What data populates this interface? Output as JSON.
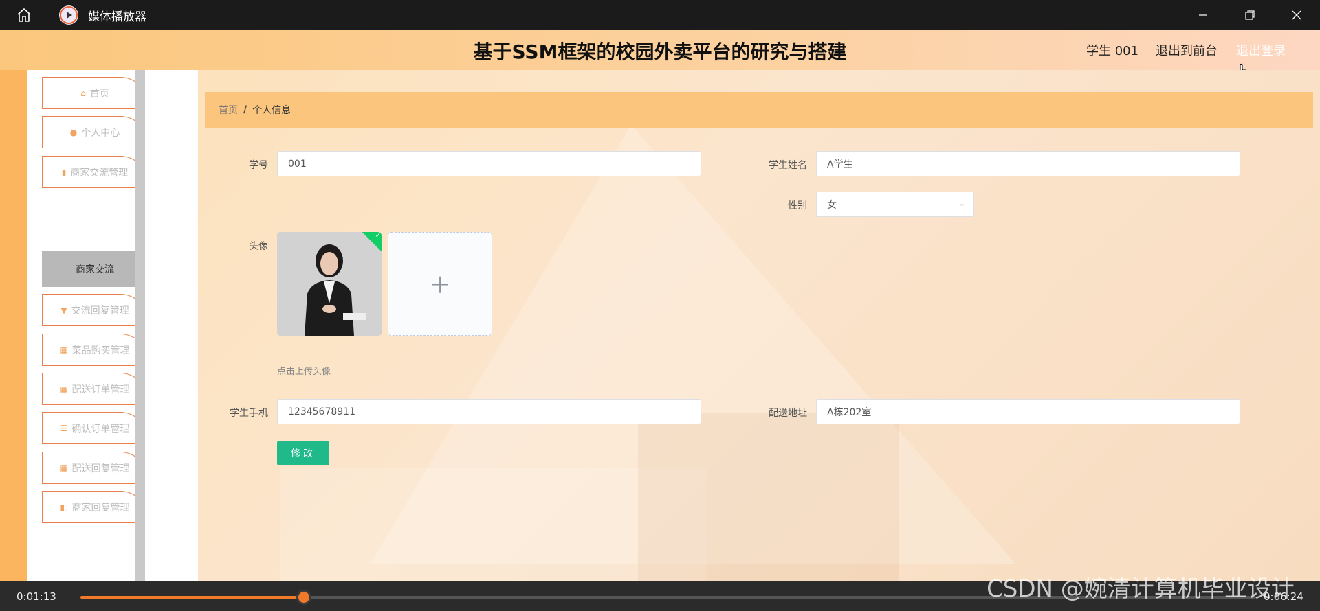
{
  "window": {
    "title": "媒体播放器",
    "controls": [
      "minimize",
      "restore",
      "close"
    ]
  },
  "header": {
    "title": "基于SSM框架的校园外卖平台的研究与搭建",
    "user": "学生 001",
    "back_to_front": "退出到前台",
    "logout": "退出登录"
  },
  "sidebar": {
    "items": [
      {
        "label": "首页",
        "icon": "home-icon",
        "has_submenu": false
      },
      {
        "label": "个人中心",
        "icon": "user-icon",
        "has_submenu": true
      },
      {
        "label": "商家交流管理",
        "icon": "chart-icon",
        "has_submenu": true
      },
      {
        "label": "交流回复管理",
        "icon": "flag-icon",
        "has_submenu": true
      },
      {
        "label": "菜品购买管理",
        "icon": "grid-icon",
        "has_submenu": true
      },
      {
        "label": "配送订单管理",
        "icon": "grid-icon",
        "has_submenu": true
      },
      {
        "label": "确认订单管理",
        "icon": "list-icon",
        "has_submenu": true
      },
      {
        "label": "配送回复管理",
        "icon": "grid-icon",
        "has_submenu": true
      },
      {
        "label": "商家回复管理",
        "icon": "thumb-icon",
        "has_submenu": true
      }
    ],
    "expanded_submenu": "商家交流"
  },
  "breadcrumb": {
    "home": "首页",
    "separator": "/",
    "current": "个人信息"
  },
  "form": {
    "student_id_label": "学号",
    "student_id_value": "001",
    "name_label": "学生姓名",
    "name_value": "A学生",
    "gender_label": "性别",
    "gender_value": "女",
    "avatar_label": "头像",
    "avatar_hint": "点击上传头像",
    "upload_plus": "+",
    "phone_label": "学生手机",
    "phone_value": "12345678911",
    "address_label": "配送地址",
    "address_value": "A栋202室",
    "submit_label": "修改"
  },
  "player": {
    "current_time": "0:01:13",
    "total_time": "0:06:24",
    "progress": 0.19
  },
  "watermark": "CSDN @婉清计算机毕业设计",
  "colors": {
    "accent": "#f07a2a",
    "submit": "#1fb98a",
    "breadcrumb_bg": "#fcc57e",
    "sidebar_border": "#e8804a"
  }
}
